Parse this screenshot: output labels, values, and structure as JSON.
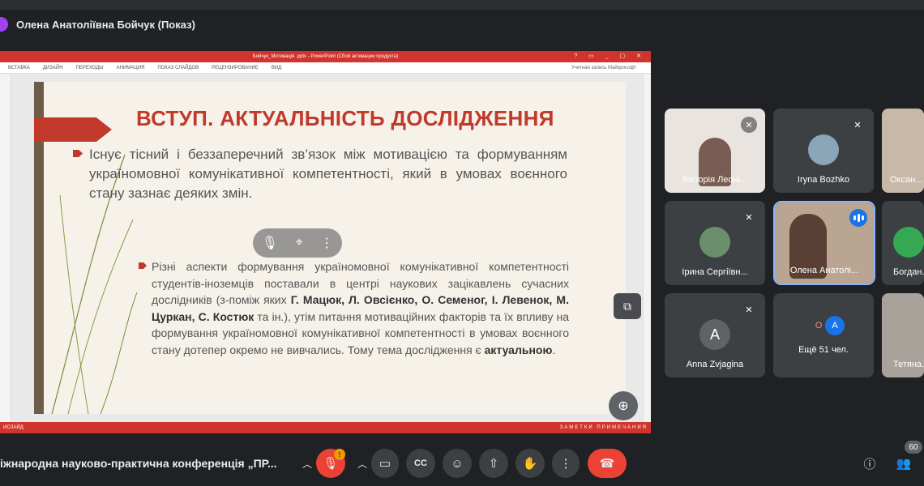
{
  "presenter": {
    "name": "Олена Анатоліївна Бойчук (Показ)"
  },
  "ppt": {
    "window_title": "Бойчук_Мотивація .pptx - PowerPoint (Сбой активации продукта)",
    "ribbon_tabs": [
      "ВСТАВКА",
      "ДИЗАЙН",
      "ПЕРЕХОДЫ",
      "АНИМАЦИЯ",
      "ПОКАЗ СЛАЙДОВ",
      "РЕЦЕНЗИРОВАНИЕ",
      "ВИД"
    ],
    "account": "Учетная запись Майкрософт",
    "status_left": "ИСЛАЙД",
    "status_right": "ЗАМЕТКИ   ПРИМЕЧАНИЯ"
  },
  "slide": {
    "title": "ВСТУП. АКТУАЛЬНІСТЬ ДОСЛІДЖЕННЯ",
    "paragraph": "Існує тісний і беззаперечний зв’язок між мотивацією та формуванням україномовної комунікативної компетентності, який в умовах воєнного стану зазнає деяких змін.",
    "sub_before": "Різні аспекти формування україномовної комунікативної компетентності студентів-іноземців поставали в центрі наукових зацікавлень сучасних дослідників (з-поміж яких ",
    "sub_names1": "Г. Мацюк, Л. Овсієнко, О. Семеног, І. Левенок, М. Цуркан, С. Костюк",
    "sub_middle": " та ін.), утім питання мотиваційних факторів та їх впливу на формування україномовної комунікативної компетентності в умовах воєнного стану дотепер окремо не вивчались. Тому тема дослідження є ",
    "sub_bold_end": "актуальною",
    "sub_end": "."
  },
  "participants": [
    {
      "name": "Вікторія Леоні...",
      "muted": true,
      "type": "video"
    },
    {
      "name": "Iryna Bozhko",
      "muted": true,
      "type": "avatar"
    },
    {
      "name": "Оксан...",
      "muted": false,
      "type": "video"
    },
    {
      "name": "Ірина Сергіївн...",
      "muted": true,
      "type": "avatar"
    },
    {
      "name": "Олена Анатолі...",
      "muted": false,
      "type": "video",
      "speaking": true
    },
    {
      "name": "Богдан...",
      "muted": false,
      "type": "avatar"
    },
    {
      "name": "Anna Zvjagina",
      "muted": true,
      "type": "letter",
      "letter": "A"
    },
    {
      "name": "Ещё 51 чел.",
      "muted": false,
      "type": "more",
      "letters": [
        "O",
        "A"
      ]
    },
    {
      "name": "Тетяна...",
      "muted": false,
      "type": "video"
    }
  ],
  "bottom": {
    "meeting_title": "іжнародна науково-практична конференція „ПР...",
    "mic_badge": "!",
    "people_count": "60"
  },
  "colors": {
    "accent_red": "#ea4335",
    "slide_red": "#c0392b",
    "active_blue": "#8ab4f8"
  }
}
